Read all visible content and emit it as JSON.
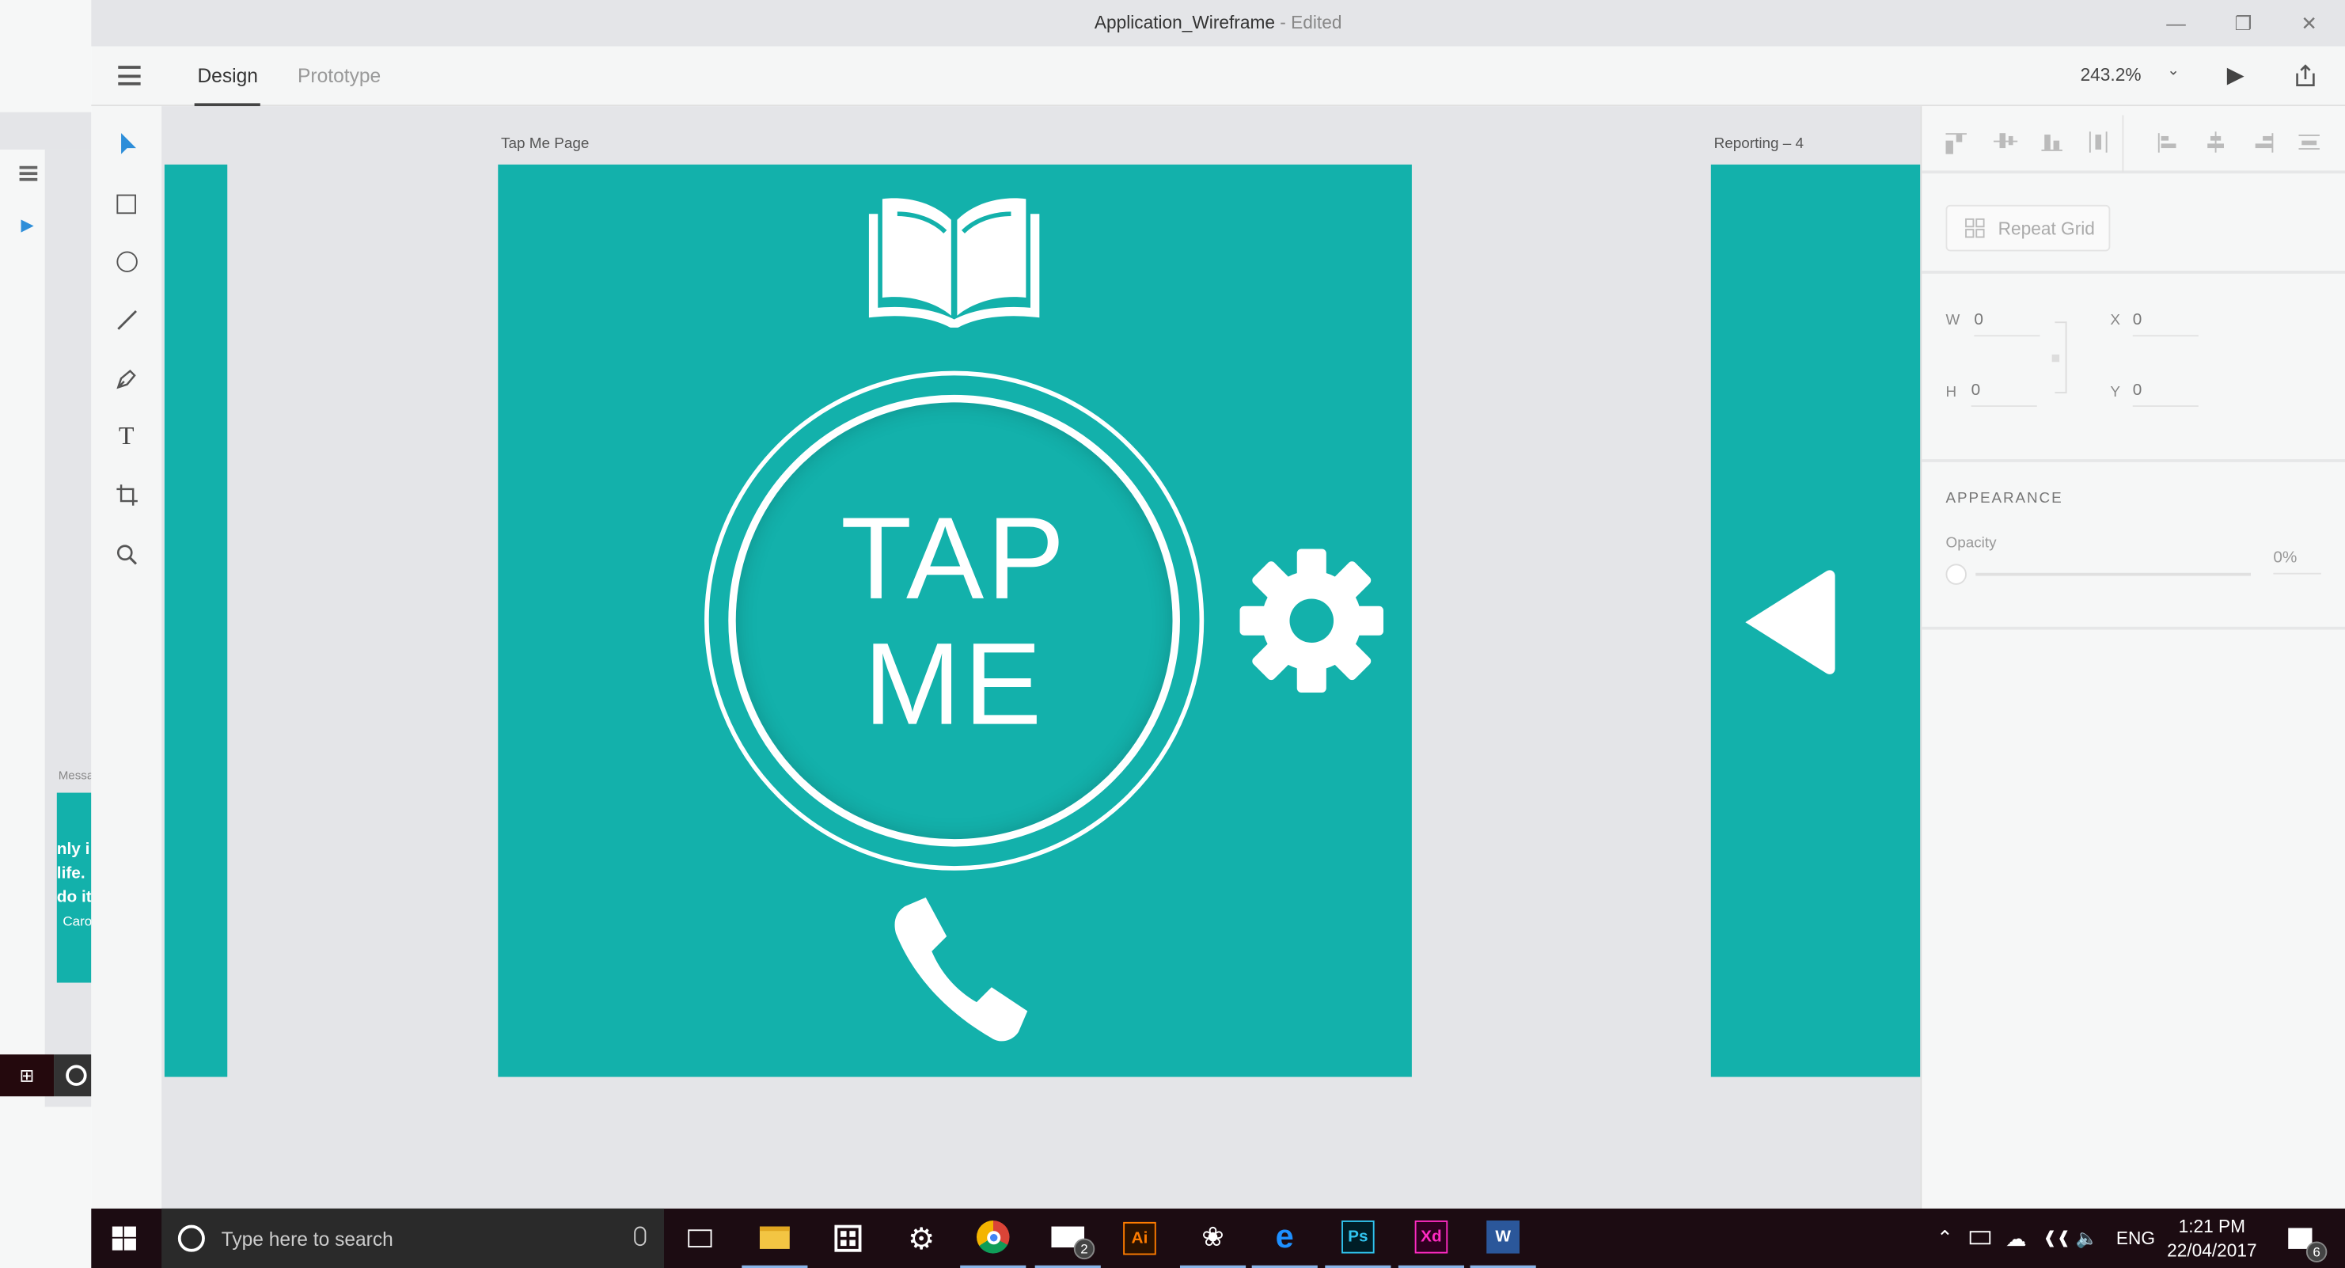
{
  "window": {
    "title": "Application_Wireframe",
    "title_status": "- Edited",
    "minimize": "—",
    "restore": "❐",
    "close": "✕"
  },
  "toolbar": {
    "tabs": [
      {
        "label": "Design"
      },
      {
        "label": "Prototype"
      }
    ],
    "zoom": "243.2%"
  },
  "background_window": {
    "artboard_label": "Messa",
    "text_lines": [
      "nly i",
      "life.",
      "do it"
    ],
    "author": "Caro"
  },
  "canvas": {
    "artboards": [
      {
        "label": "Tap Me Page"
      },
      {
        "label": "Reporting – 4"
      }
    ],
    "tap_button": {
      "line1": "TAP",
      "line2": "ME"
    },
    "colors": {
      "teal": "#13b1ab",
      "white": "#ffffff"
    }
  },
  "panel": {
    "repeat_grid": "Repeat Grid",
    "fields": {
      "w_label": "W",
      "w": "0",
      "h_label": "H",
      "h": "0",
      "x_label": "X",
      "x": "0",
      "y_label": "Y",
      "y": "0"
    },
    "appearance": {
      "heading": "APPEARANCE",
      "opacity_label": "Opacity",
      "opacity": "0%",
      "opacity_fraction": 0
    }
  },
  "taskbar": {
    "search_placeholder": "Type here to search",
    "mail_badge": "2",
    "apps": {
      "ai": "Ai",
      "ps": "Ps",
      "xd": "Xd",
      "word": "W"
    },
    "tray": {
      "lang": "ENG",
      "time": "1:21 PM",
      "date": "22/04/2017",
      "notifications": "6"
    }
  }
}
